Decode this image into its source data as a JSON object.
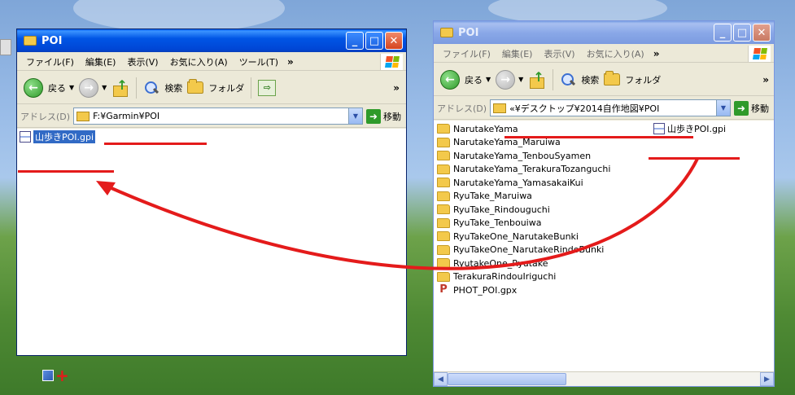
{
  "left_window": {
    "title": "POI",
    "menu": [
      "ファイル(F)",
      "編集(E)",
      "表示(V)",
      "お気に入り(A)",
      "ツール(T)"
    ],
    "menu_more": "»",
    "toolbar": {
      "back_label": "戻る",
      "search_label": "検索",
      "folders_label": "フォルダ",
      "more": "»"
    },
    "address": {
      "label": "アドレス(D)",
      "value": "F:¥Garmin¥POI",
      "go_label": "移動"
    },
    "files": [
      {
        "name": "山歩きPOI.gpi",
        "selected": true
      }
    ]
  },
  "right_window": {
    "title": "POI",
    "menu": [
      "ファイル(F)",
      "編集(E)",
      "表示(V)",
      "お気に入り(A)"
    ],
    "menu_more": "»",
    "toolbar": {
      "back_label": "戻る",
      "search_label": "検索",
      "folders_label": "フォルダ",
      "more": "»"
    },
    "address": {
      "label": "アドレス(D)",
      "value": "«¥デスクトップ¥2014自作地図¥POI",
      "go_label": "移動"
    },
    "gpi_file": {
      "name": "山歩きPOI.gpi"
    },
    "items": [
      {
        "name": "NarutakeYama",
        "icon": "folder"
      },
      {
        "name": "NarutakeYama_Maruiwa",
        "icon": "folder"
      },
      {
        "name": "NarutakeYama_TenbouSyamen",
        "icon": "folder"
      },
      {
        "name": "NarutakeYama_TerakuraTozanguchi",
        "icon": "folder"
      },
      {
        "name": "NarutakeYama_YamasakaiKui",
        "icon": "folder"
      },
      {
        "name": "RyuTake_Maruiwa",
        "icon": "folder"
      },
      {
        "name": "RyuTake_Rindouguchi",
        "icon": "folder"
      },
      {
        "name": "RyuTake_Tenbouiwa",
        "icon": "folder"
      },
      {
        "name": "RyuTakeOne_NarutakeBunki",
        "icon": "folder"
      },
      {
        "name": "RyuTakeOne_NarutakeRindoBunki",
        "icon": "folder"
      },
      {
        "name": "RyutakeOne_Ryutake",
        "icon": "folder"
      },
      {
        "name": "TerakuraRindouIriguchi",
        "icon": "folder"
      },
      {
        "name": "PHOT_POI.gpx",
        "icon": "gpx"
      }
    ]
  },
  "annotations": {
    "arrow_color": "#e41b1b",
    "underline_color": "#e41b1b"
  }
}
